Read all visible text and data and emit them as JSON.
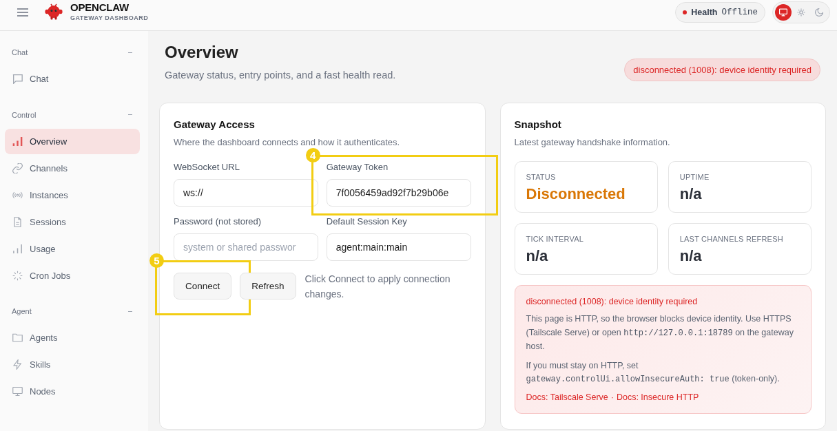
{
  "brand": {
    "name": "OPENCLAW",
    "subtitle": "GATEWAY DASHBOARD"
  },
  "health": {
    "label": "Health",
    "value": "Offline",
    "online": false
  },
  "theme_options": [
    {
      "selected": true
    },
    {
      "selected": false
    },
    {
      "selected": false
    }
  ],
  "sidebar": {
    "groups": [
      {
        "label": "Chat",
        "expanded": true,
        "items": [
          {
            "label": "Chat",
            "selected": false
          }
        ]
      },
      {
        "label": "Control",
        "expanded": true,
        "items": [
          {
            "label": "Overview",
            "selected": true
          },
          {
            "label": "Channels",
            "selected": false
          },
          {
            "label": "Instances",
            "selected": false
          },
          {
            "label": "Sessions",
            "selected": false
          },
          {
            "label": "Usage",
            "selected": false
          },
          {
            "label": "Cron Jobs",
            "selected": false
          }
        ]
      },
      {
        "label": "Agent",
        "expanded": true,
        "items": [
          {
            "label": "Agents",
            "selected": false
          },
          {
            "label": "Skills",
            "selected": false
          },
          {
            "label": "Nodes",
            "selected": false
          }
        ]
      }
    ]
  },
  "page": {
    "title": "Overview",
    "subtitle": "Gateway status, entry points, and a fast health read.",
    "error": "disconnected (1008): device identity required"
  },
  "gateway_access": {
    "title": "Gateway Access",
    "subtitle": "Where the dashboard connects and how it authenticates.",
    "fields": [
      {
        "label": "WebSocket URL",
        "value": "ws://"
      },
      {
        "label": "Gateway Token",
        "value": "7f0056459ad92f7b29b06e",
        "annotation": "4"
      },
      {
        "label": "Password (not stored)",
        "placeholder": "system or shared passwor"
      },
      {
        "label": "Default Session Key",
        "value": "agent:main:main"
      }
    ],
    "buttons": [
      {
        "label": "Connect",
        "annotation": "5"
      },
      {
        "label": "Refresh"
      }
    ],
    "hint": "Click Connect to apply connection changes."
  },
  "snapshot": {
    "title": "Snapshot",
    "subtitle": "Latest gateway handshake information.",
    "stats": [
      {
        "label": "STATUS",
        "value": "Disconnected",
        "color": "#d97706"
      },
      {
        "label": "UPTIME",
        "value": "n/a",
        "color": "#2b2f38"
      },
      {
        "label": "TICK INTERVAL",
        "value": "n/a",
        "color": "#2b2f38"
      },
      {
        "label": "LAST CHANNELS REFRESH",
        "value": "n/a",
        "color": "#2b2f38"
      }
    ],
    "alert": {
      "title": "disconnected (1008): device identity required",
      "paragraphs": [
        {
          "segments": [
            {
              "kind": "text",
              "text": "This page is HTTP, so the browser blocks device identity. Use HTTPS (Tailscale Serve) or open "
            },
            {
              "kind": "code",
              "text": "http://127.0.0.1:18789"
            },
            {
              "kind": "text",
              "text": " on the gateway host."
            }
          ]
        },
        {
          "segments": [
            {
              "kind": "text",
              "text": "If you must stay on HTTP, set "
            },
            {
              "kind": "code",
              "text": "gateway.controlUi.allowInsecureAuth: true"
            },
            {
              "kind": "text",
              "text": " (token-only)."
            }
          ]
        }
      ],
      "links": [
        "Docs: Tailscale Serve",
        "Docs: Insecure HTTP"
      ],
      "separator": "·"
    }
  }
}
